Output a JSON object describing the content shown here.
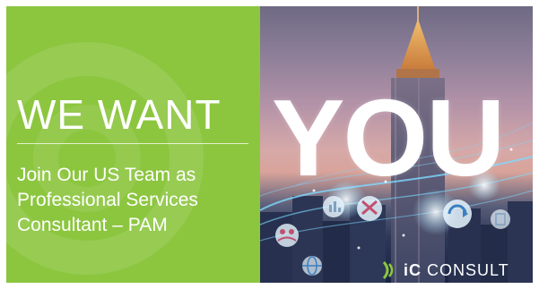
{
  "banner": {
    "headline": "WE WANT",
    "highlight": "YOU",
    "subline": [
      "Join Our US Team as",
      "Professional Services",
      "Consultant – PAM"
    ]
  },
  "logo": {
    "prefix": "iC",
    "name": " CONSULT",
    "icon": "ic-consult-logo-icon"
  },
  "colors": {
    "brand_green": "#8cc63f",
    "text": "#ffffff",
    "network_cyan": "#7fd8ff"
  }
}
